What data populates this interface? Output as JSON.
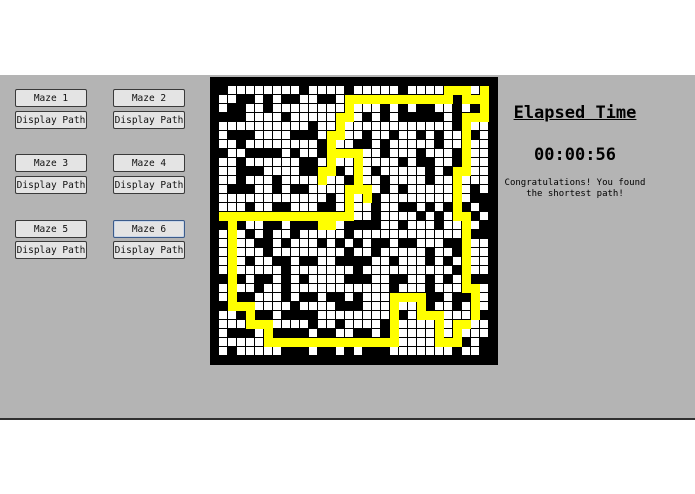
{
  "maze_buttons": [
    {
      "label": "Maze 1"
    },
    {
      "label": "Maze 2"
    },
    {
      "label": "Maze 3"
    },
    {
      "label": "Maze 4"
    },
    {
      "label": "Maze 5"
    },
    {
      "label": "Maze 6"
    }
  ],
  "path_button_label": "Display Path",
  "timer": {
    "title": "Elapsed Time",
    "value": "00:00:56"
  },
  "status": {
    "line1": "Congratulations! You found",
    "line2": "the shortest path!"
  },
  "colors": {
    "panel_bg": "#b4b4b4",
    "wall": "#000000",
    "open": "#ffffff",
    "path": "#ffff00"
  }
}
